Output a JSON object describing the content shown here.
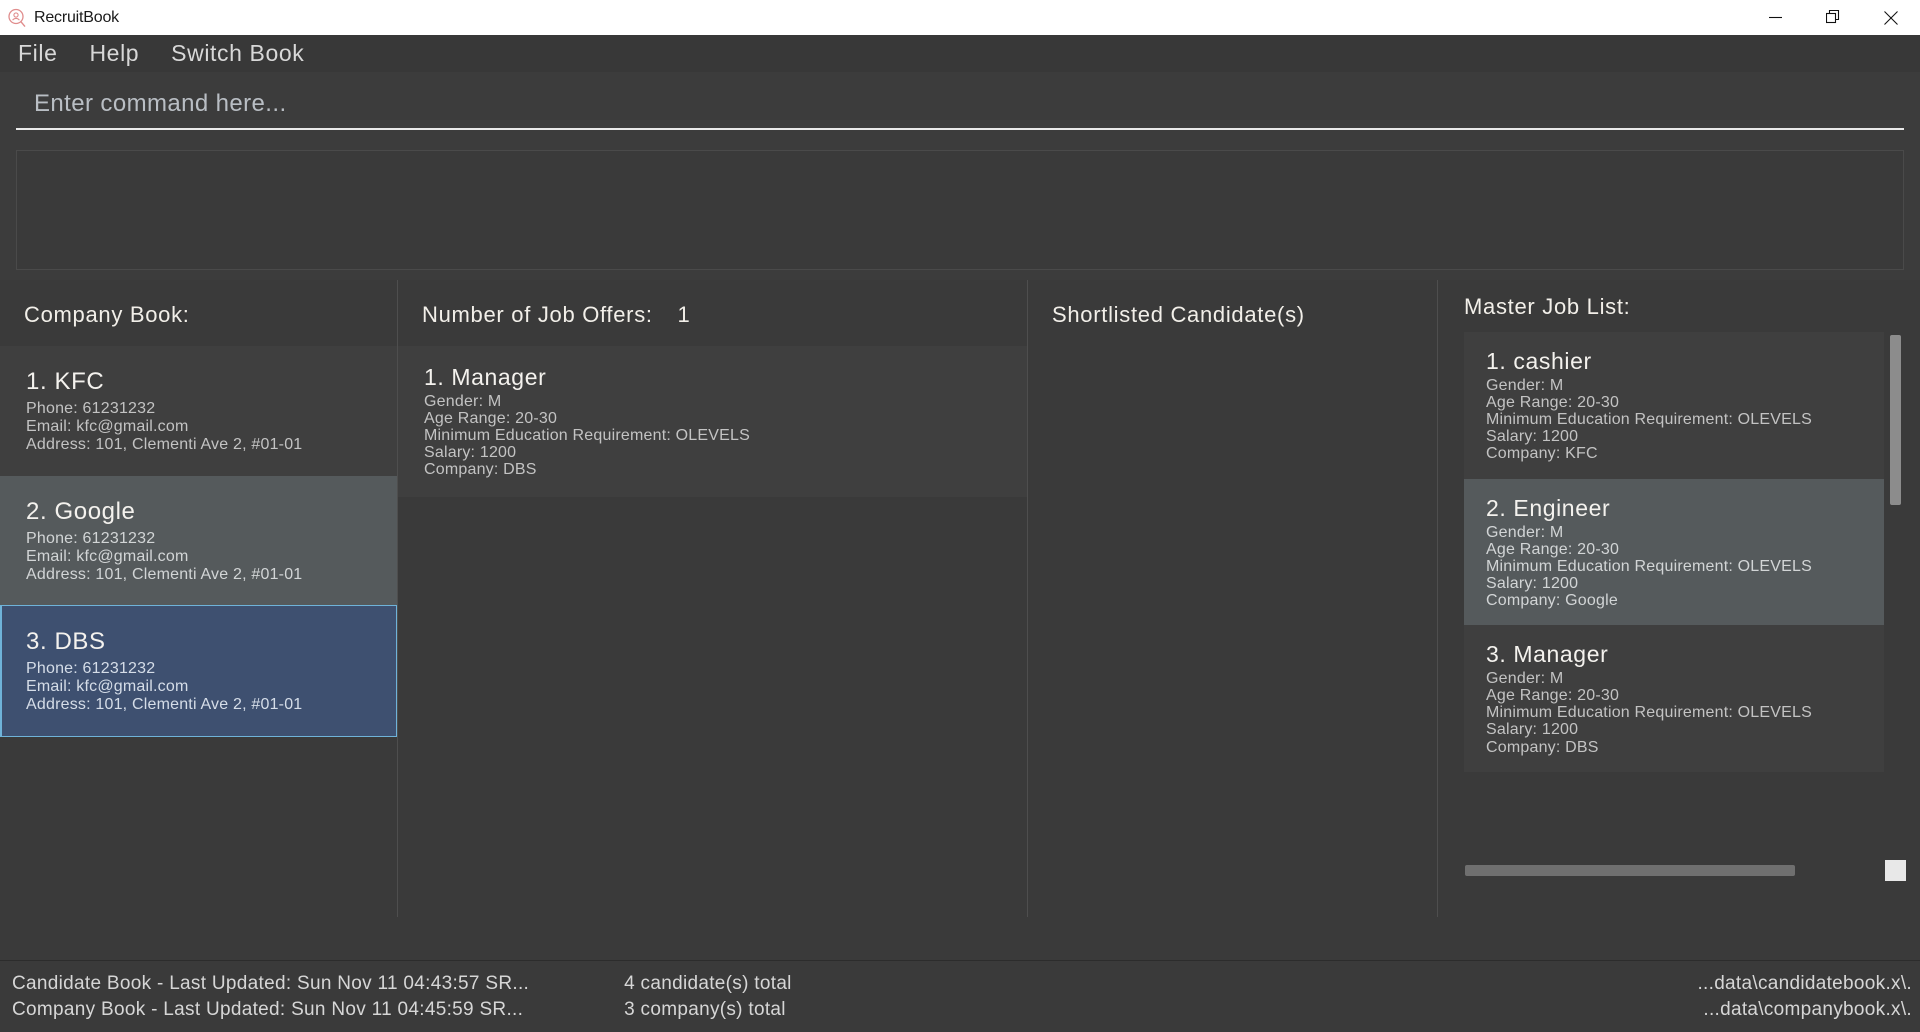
{
  "window": {
    "title": "RecruitBook",
    "icon": "recruitbook-logo-icon",
    "minimize_label": "Minimize",
    "restore_label": "Restore",
    "close_label": "Close"
  },
  "menubar": {
    "items": [
      {
        "label": "File"
      },
      {
        "label": "Help"
      },
      {
        "label": "Switch Book"
      }
    ]
  },
  "command": {
    "placeholder": "Enter command here...",
    "value": ""
  },
  "result": {
    "text": ""
  },
  "panels": {
    "company": {
      "header": "Company Book:",
      "cards": [
        {
          "title": "1.  KFC",
          "lines": [
            "Phone:  61231232",
            "Email:  kfc@gmail.com",
            "Address:  101, Clementi Ave 2, #01-01"
          ],
          "state": "normal"
        },
        {
          "title": "2.  Google",
          "lines": [
            "Phone:  61231232",
            "Email:  kfc@gmail.com",
            "Address:  101, Clementi Ave 2, #01-01"
          ],
          "state": "alt"
        },
        {
          "title": "3.  DBS",
          "lines": [
            "Phone:  61231232",
            "Email:  kfc@gmail.com",
            "Address:  101, Clementi Ave 2, #01-01"
          ],
          "state": "selected"
        }
      ]
    },
    "offers": {
      "header": "Number of Job Offers:",
      "count": "1",
      "cards": [
        {
          "title": "1.  Manager",
          "lines": [
            "Gender: M",
            "Age Range: 20-30",
            "Minimum Education Requirement: OLEVELS",
            "Salary: 1200",
            "Company: DBS"
          ],
          "state": "normal"
        }
      ]
    },
    "shortlisted": {
      "header": "Shortlisted Candidate(s)",
      "cards": []
    },
    "master": {
      "header": "Master Job List:",
      "cards": [
        {
          "title": "1.  cashier",
          "lines": [
            "Gender: M",
            "Age Range: 20-30",
            "Minimum Education Requirement: OLEVELS",
            "Salary: 1200",
            "Company: KFC"
          ],
          "state": "normal"
        },
        {
          "title": "2.  Engineer",
          "lines": [
            "Gender: M",
            "Age Range: 20-30",
            "Minimum Education Requirement: OLEVELS",
            "Salary: 1200",
            "Company: Google"
          ],
          "state": "alt"
        },
        {
          "title": "3.  Manager",
          "lines": [
            "Gender: M",
            "Age Range: 20-30",
            "Minimum Education Requirement: OLEVELS",
            "Salary: 1200",
            "Company: DBS"
          ],
          "state": "normal"
        }
      ]
    }
  },
  "statusbar": {
    "left_line1": "Candidate Book - Last Updated: Sun Nov 11 04:43:57 SR...",
    "left_line2": "Company Book - Last Updated: Sun Nov 11 04:45:59 SR...",
    "mid_line1": "4 candidate(s) total",
    "mid_line2": "3 company(s) total",
    "right_line1": "...data\\candidatebook.x\\.",
    "right_line2": "...data\\companybook.x\\."
  },
  "colors": {
    "window_chrome": "#ffffff",
    "app_bg": "#3a3a3a",
    "menu_bg": "#383838",
    "card_bg": "#3f3f3f",
    "card_alt_bg": "#555a5c",
    "card_selected_bg": "#3e5070",
    "card_selected_border": "#6fb3d9",
    "text_primary": "#f2efe9",
    "text_secondary": "#c3c3c3",
    "logo_accent": "#e08d8d"
  }
}
